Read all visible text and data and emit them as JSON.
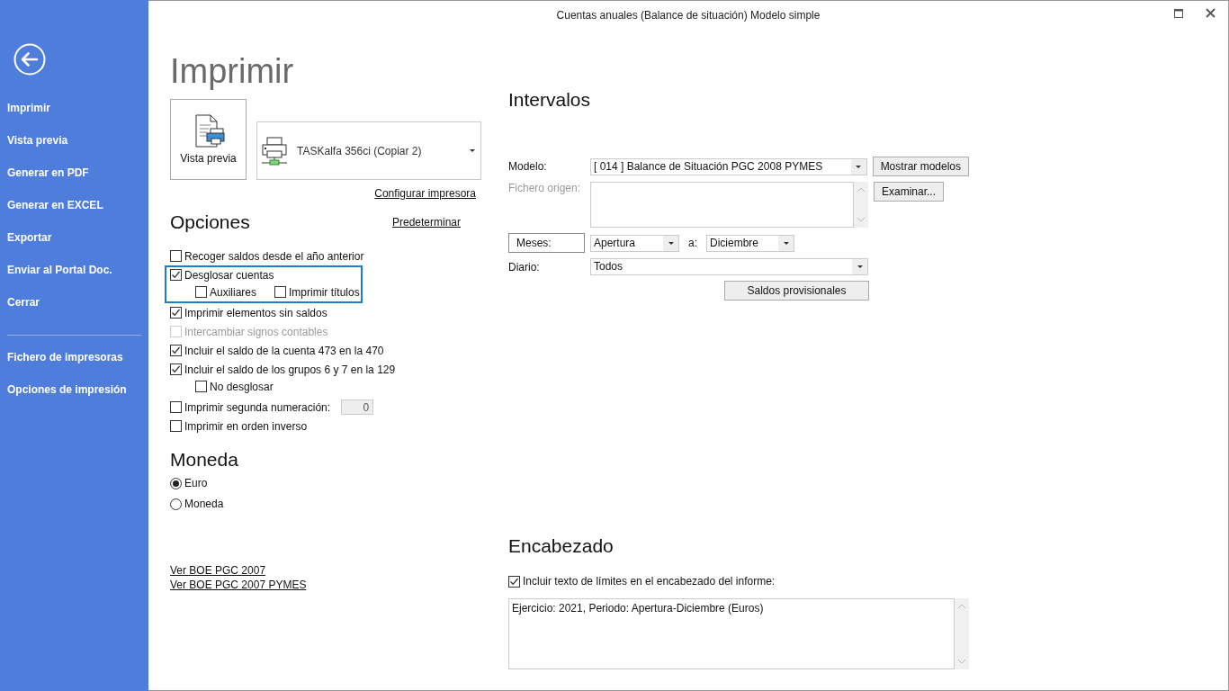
{
  "window": {
    "title": "Cuentas anuales (Balance de situación) Modelo simple"
  },
  "sidebar": {
    "items": [
      {
        "label": "Imprimir"
      },
      {
        "label": "Vista previa"
      },
      {
        "label": "Generar en PDF"
      },
      {
        "label": "Generar en EXCEL"
      },
      {
        "label": "Exportar"
      },
      {
        "label": "Enviar al Portal Doc."
      },
      {
        "label": "Cerrar"
      }
    ],
    "secondary_items": [
      {
        "label": "Fichero de impresoras"
      },
      {
        "label": "Opciones de impresión"
      }
    ]
  },
  "page_title": "Imprimir",
  "preview_button": "Vista previa",
  "printer": {
    "value": "TASKalfa 356ci (Copiar 2)"
  },
  "configure_printer_link": "Configurar impresora",
  "options": {
    "heading": "Opciones",
    "default_link": "Predeterminar",
    "items": [
      {
        "label": "Recoger saldos desde el año anterior",
        "checked": false,
        "disabled": false,
        "highlighted": false
      },
      {
        "label": "Desglosar cuentas",
        "checked": true,
        "disabled": false,
        "highlighted": true,
        "children": [
          {
            "label": "Auxiliares",
            "checked": false,
            "disabled": false
          },
          {
            "label": "Imprimir títulos",
            "checked": false,
            "disabled": false
          }
        ]
      },
      {
        "label": "Imprimir elementos sin saldos",
        "checked": true,
        "disabled": false,
        "highlighted": false
      },
      {
        "label": "Intercambiar signos contables",
        "checked": false,
        "disabled": true,
        "highlighted": false
      },
      {
        "label": "Incluir el saldo de la cuenta 473 en la 470",
        "checked": true,
        "disabled": false,
        "highlighted": false
      },
      {
        "label": "Incluir el saldo de los grupos 6 y 7 en la 129",
        "checked": true,
        "disabled": false,
        "highlighted": false,
        "children": [
          {
            "label": "No desglosar",
            "checked": false,
            "disabled": false
          }
        ]
      },
      {
        "label": "Imprimir segunda numeración:",
        "checked": false,
        "disabled": false,
        "highlighted": false,
        "value": "0"
      },
      {
        "label": "Imprimir en orden inverso",
        "checked": false,
        "disabled": false,
        "highlighted": false
      }
    ]
  },
  "currency": {
    "heading": "Moneda",
    "items": [
      {
        "label": "Euro",
        "selected": true
      },
      {
        "label": "Moneda",
        "selected": false
      }
    ]
  },
  "links": [
    "Ver BOE PGC 2007",
    "Ver BOE PGC 2007 PYMES"
  ],
  "intervals": {
    "heading": "Intervalos",
    "model": {
      "label": "Modelo:",
      "value": "[ 014 ] Balance de Situación PGC 2008 PYMES",
      "button": "Mostrar modelos"
    },
    "source_file": {
      "label": "Fichero origen:",
      "disabled": true,
      "button": "Examinar..."
    },
    "months": {
      "label": "Meses:",
      "from": "Apertura",
      "separator": "a:",
      "to": "Diciembre"
    },
    "journal": {
      "label": "Diario:",
      "value": "Todos"
    },
    "provisional_button": "Saldos provisionales"
  },
  "header": {
    "heading": "Encabezado",
    "include": {
      "label": "Incluir texto de límites en el encabezado del informe:",
      "checked": true
    },
    "text": "Ejercicio: 2021, Periodo: Apertura-Diciembre (Euros)"
  }
}
